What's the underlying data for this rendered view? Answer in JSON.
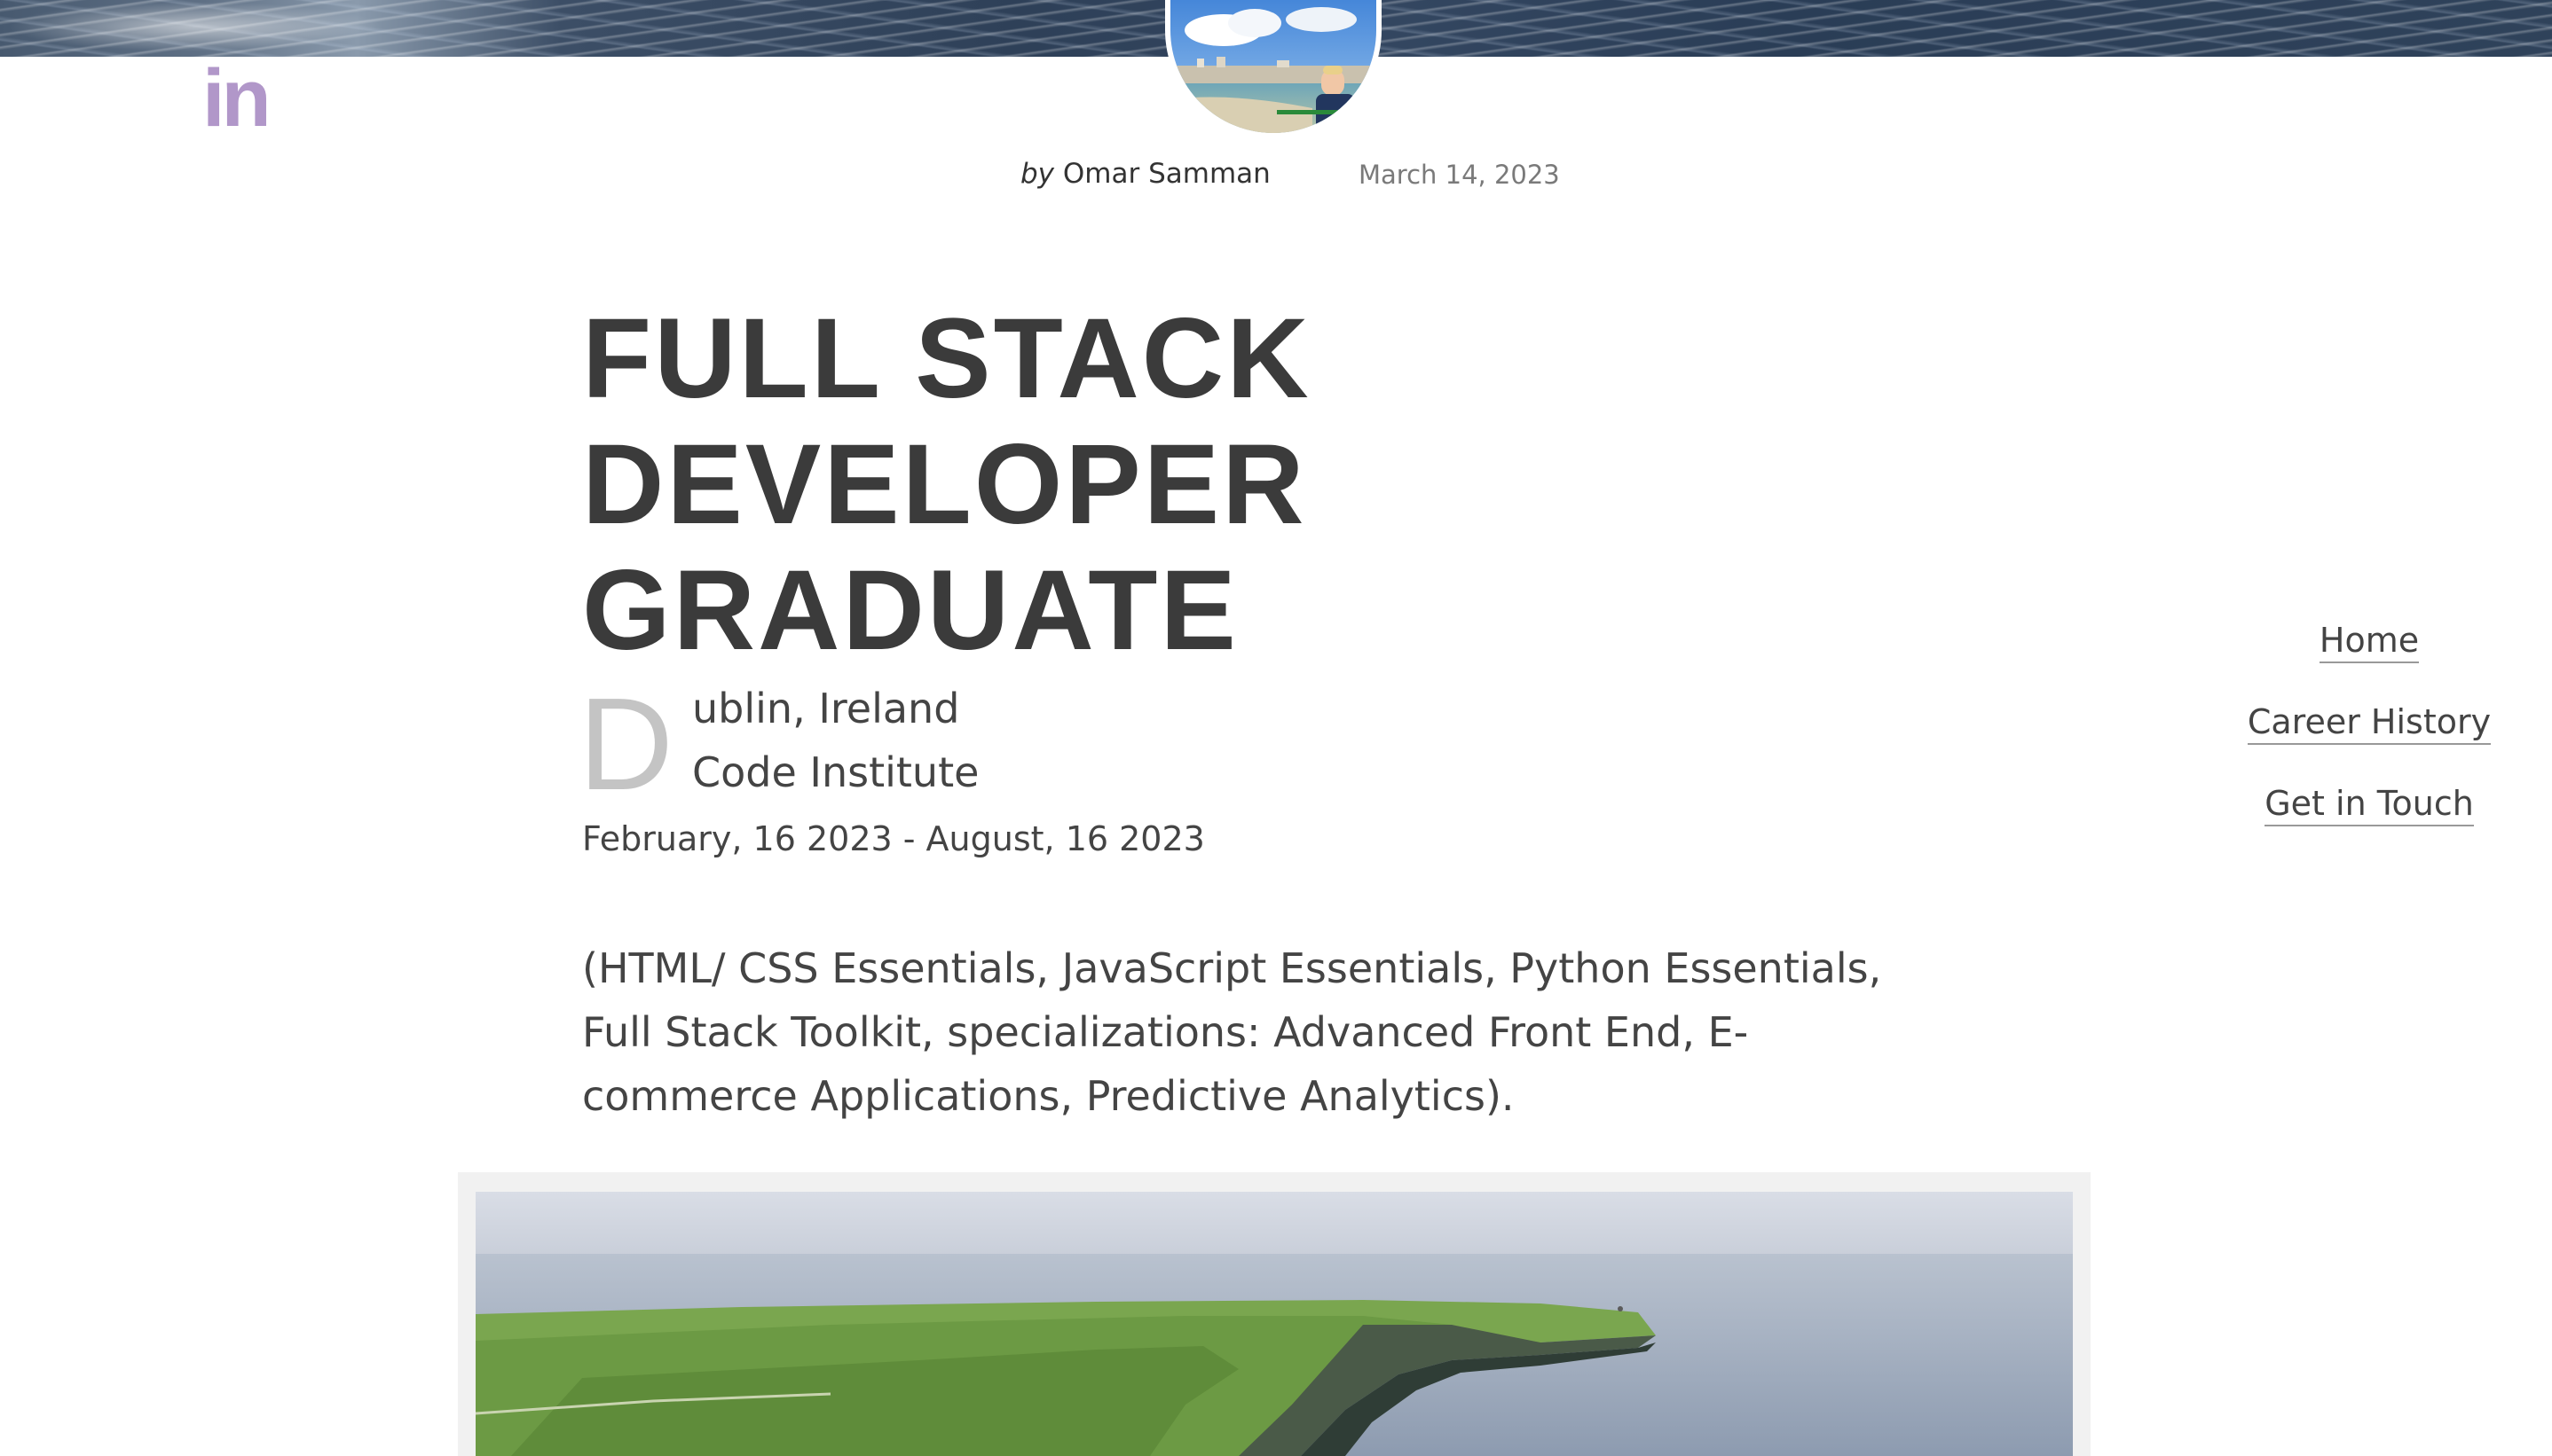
{
  "header": {
    "banner": "sea-banner",
    "avatar": "author-avatar",
    "linkedin_icon": "linkedin-icon",
    "linkedin_text": "in"
  },
  "byline": {
    "prefix": "by",
    "author": "Omar Samman",
    "date": "March 14, 2023"
  },
  "article": {
    "title_lines": [
      "FULL STACK",
      "DEVELOPER",
      "GRADUATE"
    ],
    "dropcap": "D",
    "location_rest": "ublin, Ireland",
    "institution": "Code Institute",
    "date_range": "February, 16 2023 - August, 16 2023",
    "description": "(HTML/ CSS Essentials, JavaScript Essentials, Python Essentials, Full Stack Toolkit, specializations: Advanced Front End, E-commerce Applications, Predictive Analytics)."
  },
  "nav": {
    "items": [
      "Home",
      "Career History",
      "Get in Touch"
    ]
  },
  "colors": {
    "accent": "#b197c9",
    "title": "#3b3b3b",
    "text": "#444444",
    "dropcap": "#c4c4c4"
  }
}
